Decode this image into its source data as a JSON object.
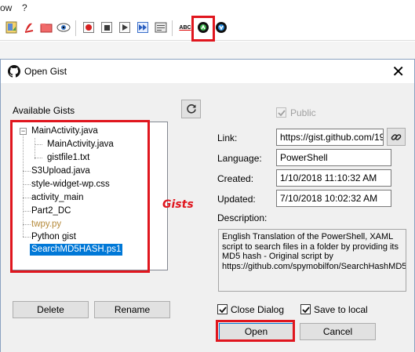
{
  "menu": {
    "items": [
      "ow",
      "?"
    ]
  },
  "toolbar": {
    "buttons": [
      "new-file-icon",
      "pdf-icon",
      "open-folder-icon",
      "eye-icon",
      "record-icon",
      "stop-icon",
      "play-icon",
      "fast-forward-icon",
      "keyboard-icon",
      "spellcheck-icon",
      "github-upload-icon",
      "github-download-icon"
    ],
    "spellcheck_text": "ABC"
  },
  "dialog": {
    "title": "Open Gist",
    "close_symbol": "✕",
    "available_label": "Available Gists",
    "tree": [
      {
        "label": "MainActivity.java",
        "level": 0,
        "expanded": true
      },
      {
        "label": "MainActivity.java",
        "level": 2
      },
      {
        "label": "gistfile1.txt",
        "level": 2
      },
      {
        "label": "S3Upload.java",
        "level": 0
      },
      {
        "label": "style-widget-wp.css",
        "level": 0
      },
      {
        "label": "activity_main",
        "level": 0
      },
      {
        "label": "Part2_DC",
        "level": 0
      },
      {
        "label": "twpy.py",
        "level": 0
      },
      {
        "label": "Python gist",
        "level": 0
      },
      {
        "label": "SearchMD5HASH.ps1",
        "level": 0,
        "selected": true
      }
    ],
    "annotation": "Gists",
    "public_label": "Public",
    "public_checked": true,
    "link_label": "Link:",
    "link_value": "https://gist.github.com/195...",
    "language_label": "Language:",
    "language_value": "PowerShell",
    "created_label": "Created:",
    "created_value": "1/10/2018 11:10:32 AM",
    "updated_label": "Updated:",
    "updated_value": "7/10/2018 10:02:32 AM",
    "description_label": "Description:",
    "description_value": "English Translation of the PowerShell, XAML script to search files in a folder by providing its MD5 hash -  Original script by https://github.com/spymobilfon/SearchHashMD5",
    "delete_label": "Delete",
    "rename_label": "Rename",
    "close_dialog_label": "Close Dialog",
    "close_dialog_checked": true,
    "save_local_label": "Save to local",
    "save_local_checked": true,
    "open_label": "Open",
    "cancel_label": "Cancel"
  },
  "colors": {
    "highlight": "#e0161e",
    "selection": "#0078d7",
    "dialog_bg": "#f0f0f0"
  }
}
